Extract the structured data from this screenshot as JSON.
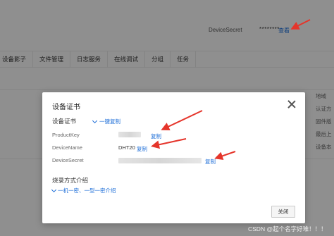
{
  "background": {
    "device_secret_label": "DeviceSecret",
    "device_secret_mask": "********",
    "view_link": "查看",
    "tabs": [
      "设备影子",
      "文件管理",
      "日志服务",
      "在线调试",
      "分组",
      "任务"
    ],
    "right_column": [
      "地域",
      "认证方",
      "固件版",
      "最后上",
      "设备本"
    ]
  },
  "modal": {
    "title": "设备证书",
    "section_title": "设备证书",
    "copy_all_label": "一键复制",
    "rows": [
      {
        "label": "ProductKey",
        "value": "",
        "copy": "复制"
      },
      {
        "label": "DeviceName",
        "value": "DHT20",
        "copy": "复制"
      },
      {
        "label": "DeviceSecret",
        "value": "",
        "copy": "复制"
      }
    ],
    "burn_title": "烧录方式介绍",
    "burn_link": "一机一密、一型一密介绍",
    "close_button": "关闭"
  },
  "colors": {
    "accent": "#1f6fd8",
    "arrow": "#e5352b",
    "overlay": "rgba(0,0,0,0.42)"
  },
  "icons": {
    "close": "close-icon",
    "expand": "chevron-down-icon"
  },
  "watermark": "CSDN @起个名字好难！！！"
}
